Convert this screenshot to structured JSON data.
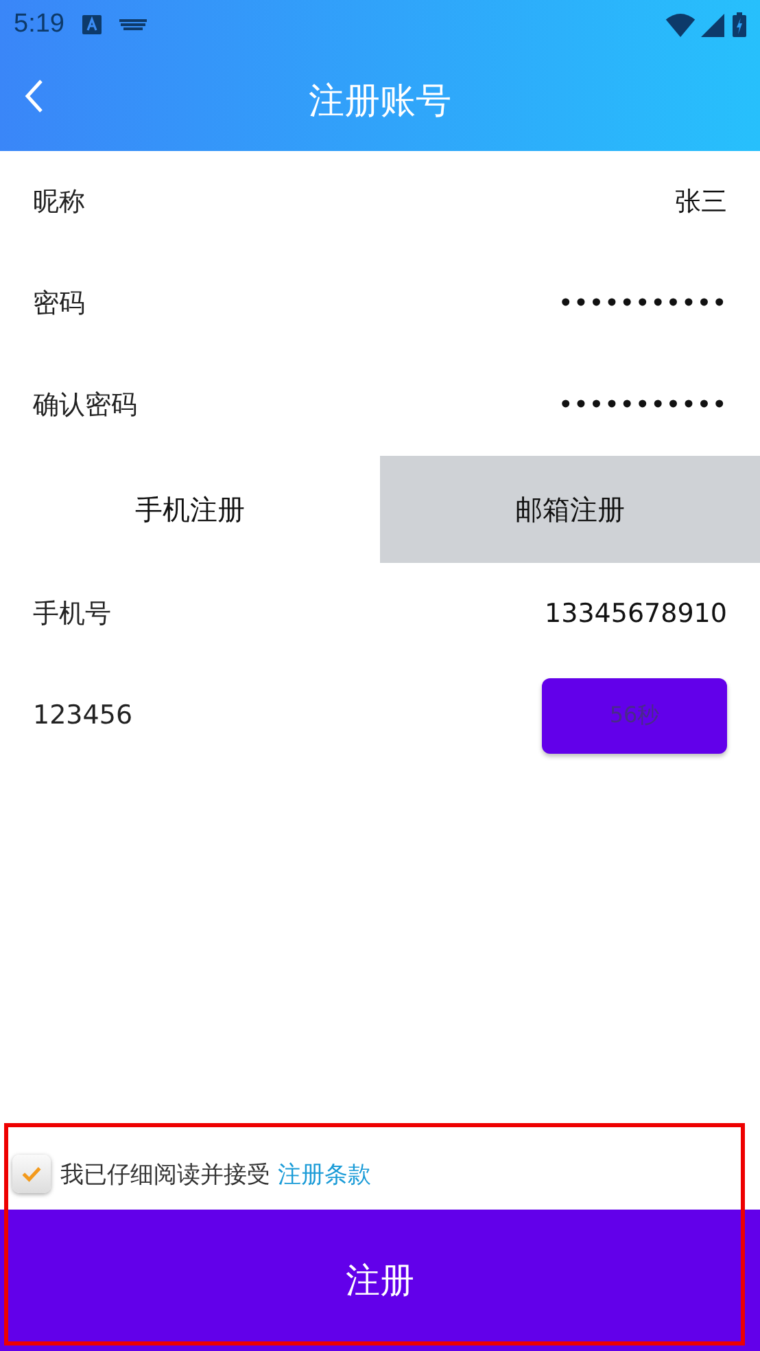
{
  "status_bar": {
    "time": "5:19"
  },
  "header": {
    "title": "注册账号"
  },
  "fields": [
    {
      "label": "昵称",
      "value": "张三"
    },
    {
      "label": "密码",
      "value": "•••••••••••"
    },
    {
      "label": "确认密码",
      "value": "•••••••••••"
    }
  ],
  "tabs": [
    {
      "label": "手机注册",
      "selected": true
    },
    {
      "label": "邮箱注册",
      "selected": false
    }
  ],
  "phone": {
    "label": "手机号",
    "value": "13345678910"
  },
  "code": {
    "value": "123456",
    "button": "56秒",
    "disabled": true
  },
  "agreement": {
    "checked": true,
    "text": "我已仔细阅读并接受",
    "link": "注册条款"
  },
  "submit": "注册"
}
